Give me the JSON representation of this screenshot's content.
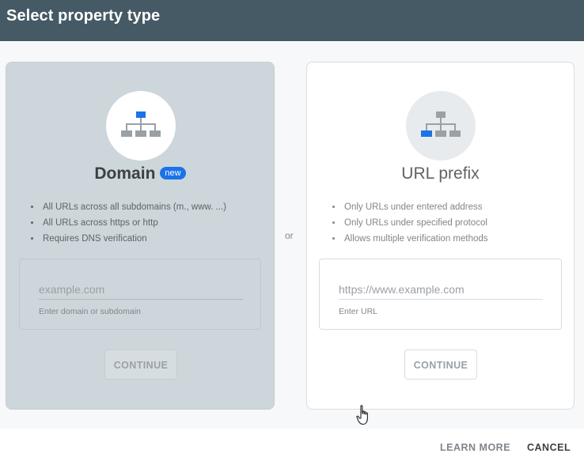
{
  "dialog": {
    "title": "Select property type"
  },
  "domain_card": {
    "title": "Domain",
    "badge": "new",
    "features": [
      "All URLs across all subdomains (m., www. ...)",
      "All URLs across https or http",
      "Requires DNS verification"
    ],
    "input_placeholder": "example.com",
    "input_value": "",
    "helper_text": "Enter domain or subdomain",
    "continue_label": "CONTINUE",
    "icon": "sitemap-icon"
  },
  "separator": {
    "label": "or"
  },
  "url_card": {
    "title": "URL prefix",
    "features": [
      "Only URLs under entered address",
      "Only URLs under specified protocol",
      "Allows multiple verification methods"
    ],
    "input_placeholder": "https://www.example.com",
    "input_value": "",
    "helper_text": "Enter URL",
    "continue_label": "CONTINUE",
    "icon": "sitemap-icon"
  },
  "footer": {
    "learn_more_label": "LEARN MORE",
    "cancel_label": "CANCEL"
  },
  "colors": {
    "header": "#455a64",
    "accent": "#1a73e8",
    "selected_card": "#cdd6da"
  }
}
